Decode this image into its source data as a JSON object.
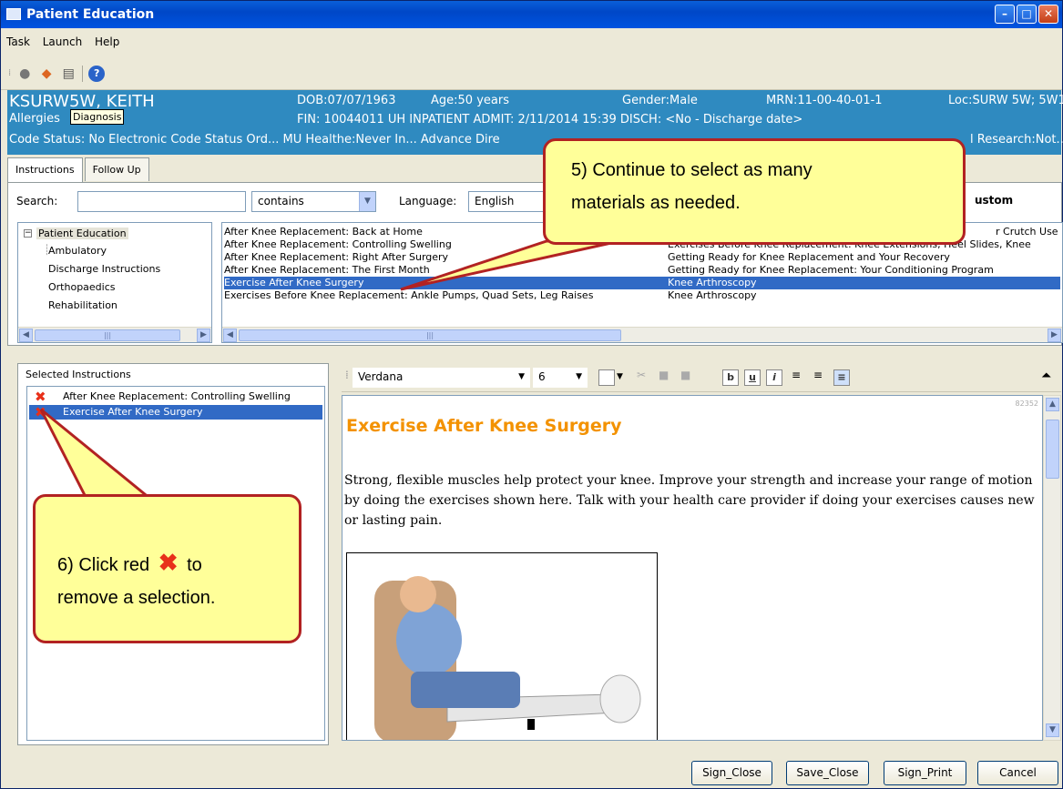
{
  "window": {
    "title": "Patient Education"
  },
  "menu": [
    "Task",
    "Launch",
    "Help"
  ],
  "toolbar_icons": [
    "apple-icon",
    "palette-icon",
    "document-icon",
    "help-icon"
  ],
  "patient": {
    "name": "KSURW5W, KEITH",
    "dob": "DOB:07/07/1963",
    "age": "Age:50 years",
    "gender": "Gender:Male",
    "mrn": "MRN:11-00-40-01-1",
    "loc": "Loc:SURW 5W; 5W1...",
    "allergies": "Allergies",
    "fin_line": "FIN: 10044011   UH INPATIENT   ADMIT:  2/11/2014 15:39   DISCH:  <No - Discharge date>",
    "code_status": "Code Status: No Electronic Code Status Ord... MU Healthe:Never In... Advance Dire",
    "research": "l Research:Not..."
  },
  "tooltip": "Diagnosis",
  "tabs": [
    "Instructions",
    "Follow Up"
  ],
  "search": {
    "label": "Search:",
    "value": "",
    "mode": "contains",
    "language_label": "Language:",
    "language": "English",
    "custom_label": "ustom"
  },
  "tree": {
    "root": "Patient Education",
    "children": [
      "Ambulatory",
      "Discharge Instructions",
      "Orthopaedics",
      "Rehabilitation"
    ]
  },
  "list_col1": [
    "After Knee Replacement: Back at Home",
    "After Knee Replacement: Controlling Swelling",
    "After Knee Replacement: Right After Surgery",
    "After Knee Replacement: The First Month",
    "Exercise After Knee Surgery",
    "Exercises Before Knee Replacement: Ankle Pumps, Quad Sets, Leg Raises"
  ],
  "list_col2": [
    "r Crutch Use",
    "Exercises Before Knee Replacement: Knee Extensions, Heel Slides, Knee",
    "Getting Ready for Knee Replacement and Your Recovery",
    "Getting Ready for Knee Replacement: Your Conditioning Program",
    "Knee Arthroscopy",
    "Knee Arthroscopy"
  ],
  "selected": {
    "title": "Selected Instructions",
    "items": [
      "After Knee Replacement: Controlling Swelling",
      "Exercise After Knee Surgery"
    ]
  },
  "format": {
    "font": "Verdana",
    "size": "6"
  },
  "document": {
    "id": "82352",
    "heading": "Exercise After Knee Surgery",
    "body": "Strong, flexible muscles help protect your knee. Improve your strength and increase your range of motion by doing the exercises shown here. Talk with your health care provider if doing your exercises causes new or lasting pain."
  },
  "buttons": [
    "Sign_Close",
    "Save_Close",
    "Sign_Print",
    "Cancel"
  ],
  "callouts": {
    "step5": "5) Continue to select as many materials as needed.",
    "step6_a": "6) Click red",
    "step6_b": "to",
    "step6_c": "remove a selection."
  },
  "colors": {
    "banner": "#2f8ac0",
    "heading": "#f39200",
    "callout_fill": "#ffff99",
    "callout_border": "#b22222",
    "selection": "#316ac5"
  }
}
